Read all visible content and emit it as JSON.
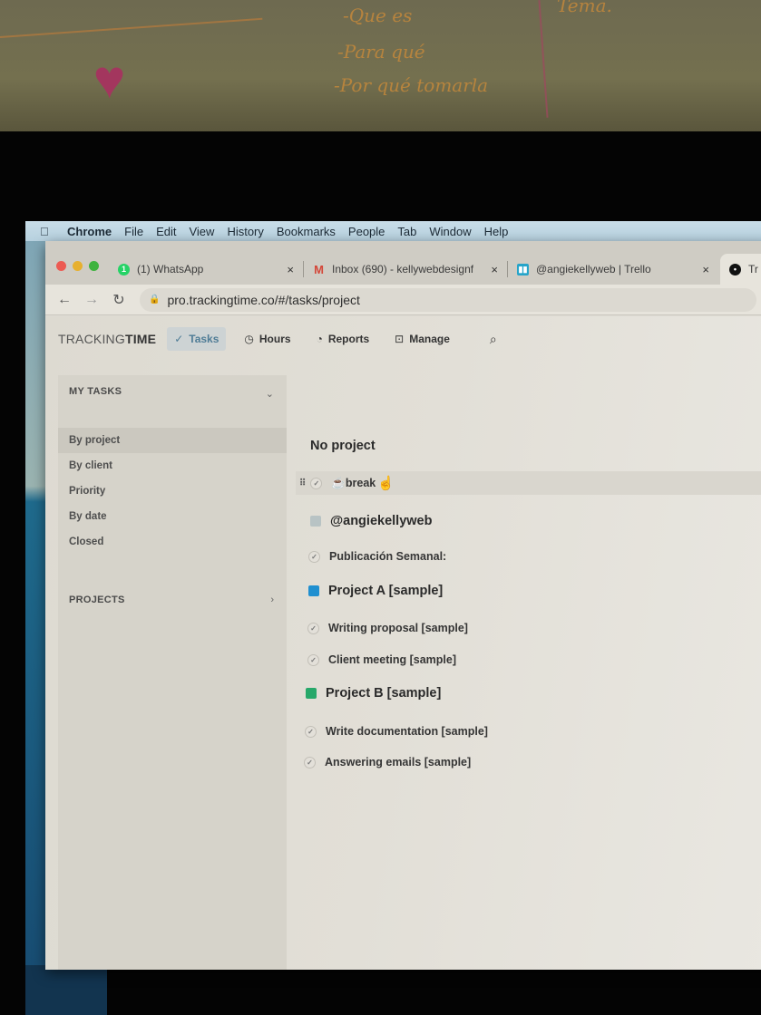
{
  "background": {
    "handwriting": [
      "-Que es",
      "-Para qué",
      "-Por qué tomarla",
      "Tema."
    ]
  },
  "menubar": {
    "apple_icon": "apple-icon",
    "items": [
      "Chrome",
      "File",
      "Edit",
      "View",
      "History",
      "Bookmarks",
      "People",
      "Tab",
      "Window",
      "Help"
    ]
  },
  "browser": {
    "tabs": [
      {
        "title": "(1) WhatsApp",
        "favicon": "whatsapp-icon",
        "badge": "1",
        "color": "#25d366"
      },
      {
        "title": "Inbox (690) - kellywebdesignf",
        "favicon": "gmail-icon",
        "color": "#d44638"
      },
      {
        "title": "@angiekellyweb | Trello",
        "favicon": "trello-icon",
        "color": "#26a4c9"
      },
      {
        "title": "Tr",
        "favicon": "trackingtime-icon",
        "color": "#111111"
      }
    ],
    "close_glyph": "×",
    "url": "pro.trackingtime.co/#/tasks/project"
  },
  "app": {
    "logo": {
      "light": "TRACKING",
      "bold": "TIME"
    },
    "nav": [
      {
        "label": "Tasks",
        "icon": "✓",
        "active": true
      },
      {
        "label": "Hours",
        "icon": "◷",
        "active": false
      },
      {
        "label": "Reports",
        "icon": "◔",
        "active": false
      },
      {
        "label": "Manage",
        "icon": "⊡",
        "active": false
      }
    ],
    "accent": "#4f7c96",
    "sidebar": {
      "my_tasks_label": "MY TASKS",
      "items": [
        "By project",
        "By client",
        "Priority",
        "By date",
        "Closed"
      ],
      "active_item": "By project",
      "projects_label": "PROJECTS"
    },
    "groups": [
      {
        "title": "No project",
        "color": null,
        "tasks": [
          "☕break"
        ]
      },
      {
        "title": "@angiekellyweb",
        "color": "#b8c3c4",
        "tasks": [
          "Publicación Semanal:"
        ]
      },
      {
        "title": "Project A [sample]",
        "color": "#1f8fd0",
        "tasks": [
          "Writing proposal [sample]",
          "Client meeting [sample]"
        ]
      },
      {
        "title": "Project B [sample]",
        "color": "#27a86a",
        "tasks": [
          "Write documentation [sample]",
          "Answering emails [sample]"
        ]
      }
    ]
  }
}
